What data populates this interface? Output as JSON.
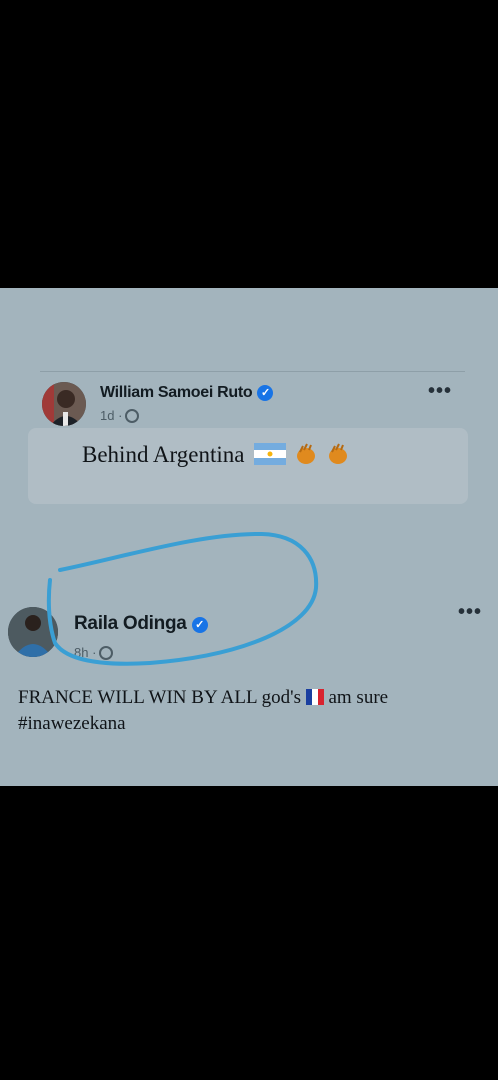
{
  "posts": [
    {
      "author": "William Samoei Ruto",
      "verified": true,
      "time": "1d",
      "privacy_icon": "globe-icon",
      "text": "Behind Argentina",
      "emojis": [
        "argentina-flag-icon",
        "clapping-hands-icon",
        "clapping-hands-icon"
      ]
    },
    {
      "author": "Raila Odinga",
      "verified": true,
      "time": "8h",
      "privacy_icon": "globe-icon",
      "text_part1": "FRANCE WILL WIN BY ALL god's",
      "text_part2": "am sure",
      "hashtag": "#inawezekana",
      "emojis": [
        "france-flag-icon"
      ]
    }
  ],
  "separator": "·",
  "more_label": "•••",
  "annotation_color": "#3a9fd4"
}
